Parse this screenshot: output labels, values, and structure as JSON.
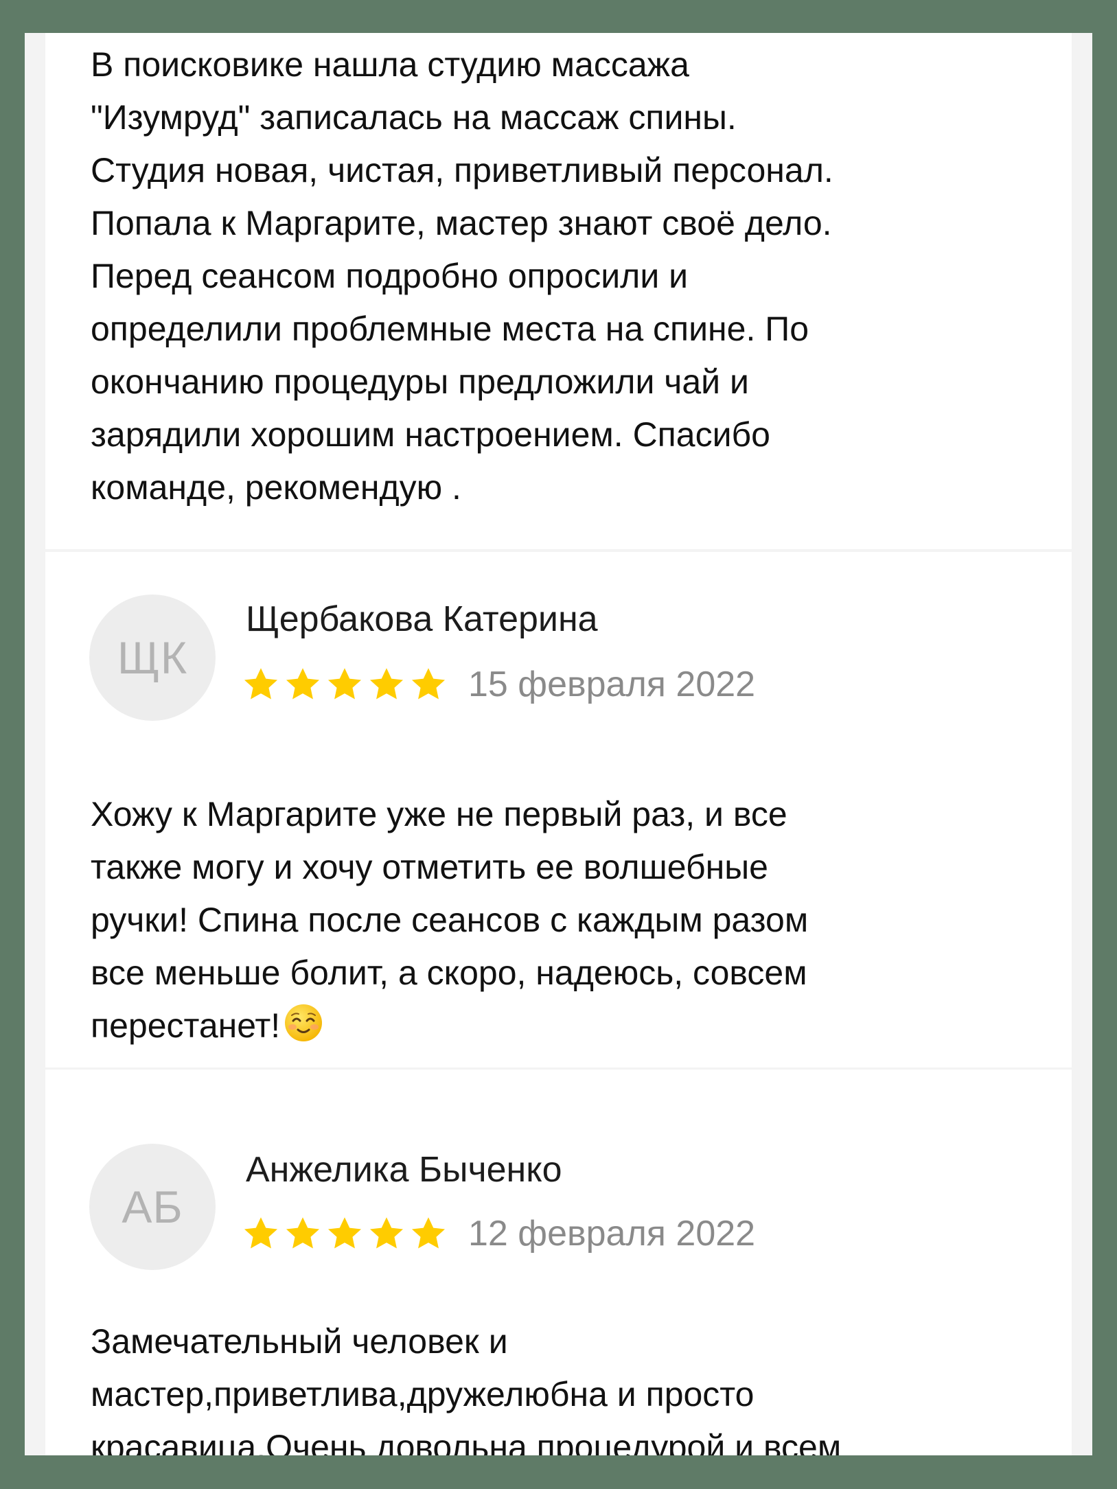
{
  "reviews": [
    {
      "text": "В поисковике нашла студию массажа\n\"Изумруд\" записалась на массаж спины.\nСтудия новая, чистая, приветливый персонал.\nПопала к Маргарите, мастер знают своё дело.\nПеред сеансом подробно опросили и\nопределили проблемные места на спине. По\nокончанию процедуры предложили чай и\nзарядили хорошим настроением. Спасибо\nкоманде, рекомендую ."
    },
    {
      "initials": "ЩК",
      "author": "Щербакова Катерина",
      "rating": 5,
      "date": "15 февраля 2022",
      "text": "Хожу к Маргарите уже не первый раз, и все\nтакже могу и хочу отметить ее волшебные\nручки! Спина после сеансов с каждым разом\nвсе меньше болит, а скоро, надеюсь, совсем\nперестанет!",
      "emoji": "smiling-face-icon"
    },
    {
      "initials": "АБ",
      "author": "Анжелика Быченко",
      "rating": 5,
      "date": "12 февраля 2022",
      "text": "Замечательный человек и\nмастер,приветлива,дружелюбна и просто\nкрасавица.Очень довольна процедурой и всем\nсоветую"
    }
  ],
  "colors": {
    "outer_background": "#5f7b67",
    "card_background": "#ffffff",
    "separator": "#f3f3f3",
    "star": "#ffcc00",
    "avatar_background": "#ededed",
    "avatar_text": "#b3b3b3",
    "date_text": "#8a8a8a"
  }
}
